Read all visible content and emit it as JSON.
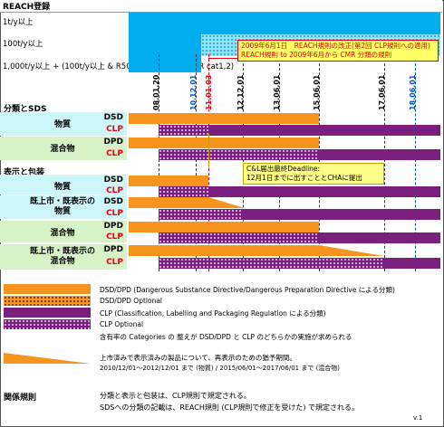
{
  "header": {
    "title": "REACH登録"
  },
  "tonnage": {
    "row1": "1t/y以上",
    "row2": "100t/y以上",
    "row3": "1,000t/y以上 + (100t/y以上 & R50/53) + (1t/y & CMR cat1,2)"
  },
  "callout_top": {
    "line1": "2009年6月1日　REACH規則の改正(第2回 CLP規則への適用)",
    "line2": "REACH規則 to 2009年6月から CMR 分類の規則"
  },
  "callout_mid": {
    "line1": "C&L届出最終Deadline:",
    "line2": "12月1日までに出すこととCHAに提出"
  },
  "dates": [
    "08.01.20",
    "10.12.01",
    "11.01.03",
    "12.12.01",
    "13.06.01",
    "15.06.01",
    "17.06.01",
    "18.06.01"
  ],
  "sections": {
    "classification": "分類とSDS",
    "labelling": "表示と包装",
    "related": "関係規則"
  },
  "rows": {
    "substance": "物質",
    "mixture": "混合物",
    "substance_label": "物質",
    "marketed_substance": "既上市・既表示の\n物質",
    "mixture_label": "混合物",
    "marketed_mixture": "既上市・既表示の\n混合物"
  },
  "codes": {
    "dsd": "DSD",
    "clp": "CLP",
    "dpd": "DPD"
  },
  "legend": {
    "orange": "DSD/DPD (Dangerous Substance Directive/Dangerous Preparation Directive による分類)",
    "orange_opt": "DSD/DPD Optional",
    "purple": "CLP (Classification, Labelling and Packaging Regulation による分類)",
    "purple_opt": "CLP Optional",
    "both": "含有率の Categories の 整えが DSD/DPD と CLP のどちらかの実施が求められる",
    "grad1": "上市済みで表示済みの製品について、再表示のための猶予期間。",
    "grad2": "2010/12/01～2012/12/01 まで (物質) / 2015/06/01～2017/06/01 まで (混合物)"
  },
  "related": {
    "line1": "分類と表示と包装は、CLP規則で規定される。",
    "line2": "SDSへの分類の記載は、REACH規則 (CLP規則で修正を受けた) で規定される。"
  },
  "footer": {
    "version": "v.1"
  },
  "colors": {
    "orange": "#f7941d",
    "purple": "#7a1f7e",
    "cyan": "#00aeef",
    "red": "#e60012"
  }
}
